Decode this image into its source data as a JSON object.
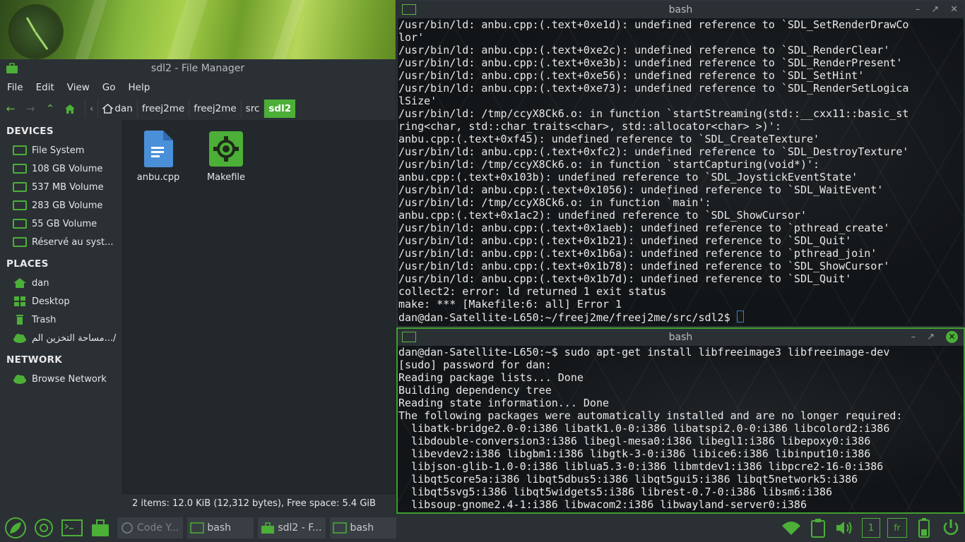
{
  "file_manager": {
    "title": "sdl2 - File Manager",
    "menu": [
      "File",
      "Edit",
      "View",
      "Go",
      "Help"
    ],
    "breadcrumb": [
      "dan",
      "freej2me",
      "freej2me",
      "src",
      "sdl2"
    ],
    "sections": {
      "devices": "DEVICES",
      "places": "PLACES",
      "network": "NETWORK"
    },
    "devices": [
      "File System",
      "108 GB Volume",
      "537 MB Volume",
      "283 GB Volume",
      "55 GB Volume",
      "Réservé au syst..."
    ],
    "places": [
      "dan",
      "Desktop",
      "Trash",
      "مساحة التخزين الم.../"
    ],
    "network": [
      "Browse Network"
    ],
    "files": [
      {
        "name": "anbu.cpp",
        "icon": "text-file-icon"
      },
      {
        "name": "Makefile",
        "icon": "makefile-gear-icon"
      }
    ],
    "status": "2 items: 12.0 KiB (12,312 bytes), Free space: 5.4 GiB"
  },
  "terminal_top": {
    "title": "bash",
    "lines": [
      "/usr/bin/ld: anbu.cpp:(.text+0xe1d): undefined reference to `SDL_SetRenderDrawCo",
      "lor'",
      "/usr/bin/ld: anbu.cpp:(.text+0xe2c): undefined reference to `SDL_RenderClear'",
      "/usr/bin/ld: anbu.cpp:(.text+0xe3b): undefined reference to `SDL_RenderPresent'",
      "/usr/bin/ld: anbu.cpp:(.text+0xe56): undefined reference to `SDL_SetHint'",
      "/usr/bin/ld: anbu.cpp:(.text+0xe73): undefined reference to `SDL_RenderSetLogica",
      "lSize'",
      "/usr/bin/ld: /tmp/ccyX8Ck6.o: in function `startStreaming(std::__cxx11::basic_st",
      "ring<char, std::char_traits<char>, std::allocator<char> >)':",
      "anbu.cpp:(.text+0xf45): undefined reference to `SDL_CreateTexture'",
      "/usr/bin/ld: anbu.cpp:(.text+0xfc2): undefined reference to `SDL_DestroyTexture'",
      "/usr/bin/ld: /tmp/ccyX8Ck6.o: in function `startCapturing(void*)':",
      "anbu.cpp:(.text+0x103b): undefined reference to `SDL_JoystickEventState'",
      "/usr/bin/ld: anbu.cpp:(.text+0x1056): undefined reference to `SDL_WaitEvent'",
      "/usr/bin/ld: /tmp/ccyX8Ck6.o: in function `main':",
      "anbu.cpp:(.text+0x1ac2): undefined reference to `SDL_ShowCursor'",
      "/usr/bin/ld: anbu.cpp:(.text+0x1aeb): undefined reference to `pthread_create'",
      "/usr/bin/ld: anbu.cpp:(.text+0x1b21): undefined reference to `SDL_Quit'",
      "/usr/bin/ld: anbu.cpp:(.text+0x1b6a): undefined reference to `pthread_join'",
      "/usr/bin/ld: anbu.cpp:(.text+0x1b78): undefined reference to `SDL_ShowCursor'",
      "/usr/bin/ld: anbu.cpp:(.text+0x1b7d): undefined reference to `SDL_Quit'",
      "collect2: error: ld returned 1 exit status",
      "make: *** [Makefile:6: all] Error 1"
    ],
    "prompt": "dan@dan-Satellite-L650:~/freej2me/freej2me/src/sdl2$ "
  },
  "terminal_bottom": {
    "title": "bash",
    "lines": [
      "dan@dan-Satellite-L650:~$ sudo apt-get install libfreeimage3 libfreeimage-dev",
      "[sudo] password for dan:",
      "Reading package lists... Done",
      "Building dependency tree",
      "Reading state information... Done",
      "The following packages were automatically installed and are no longer required:",
      "  libatk-bridge2.0-0:i386 libatk1.0-0:i386 libatspi2.0-0:i386 libcolord2:i386",
      "  libdouble-conversion3:i386 libegl-mesa0:i386 libegl1:i386 libepoxy0:i386",
      "  libevdev2:i386 libgbm1:i386 libgtk-3-0:i386 libice6:i386 libinput10:i386",
      "  libjson-glib-1.0-0:i386 liblua5.3-0:i386 libmtdev1:i386 libpcre2-16-0:i386",
      "  libqt5core5a:i386 libqt5dbus5:i386 libqt5gui5:i386 libqt5network5:i386",
      "  libqt5svg5:i386 libqt5widgets5:i386 librest-0.7-0:i386 libsm6:i386",
      "  libsoup-gnome2.4-1:i386 libwacom2:i386 libwayland-server0:i386"
    ]
  },
  "taskbar": {
    "tasks": [
      "Code Y...",
      "bash",
      "sdl2 - F...",
      "bash"
    ],
    "tray_workspace": "1",
    "tray_keyboard": "fr"
  },
  "colors": {
    "accent": "#4caf37",
    "panel": "#2b3035"
  }
}
